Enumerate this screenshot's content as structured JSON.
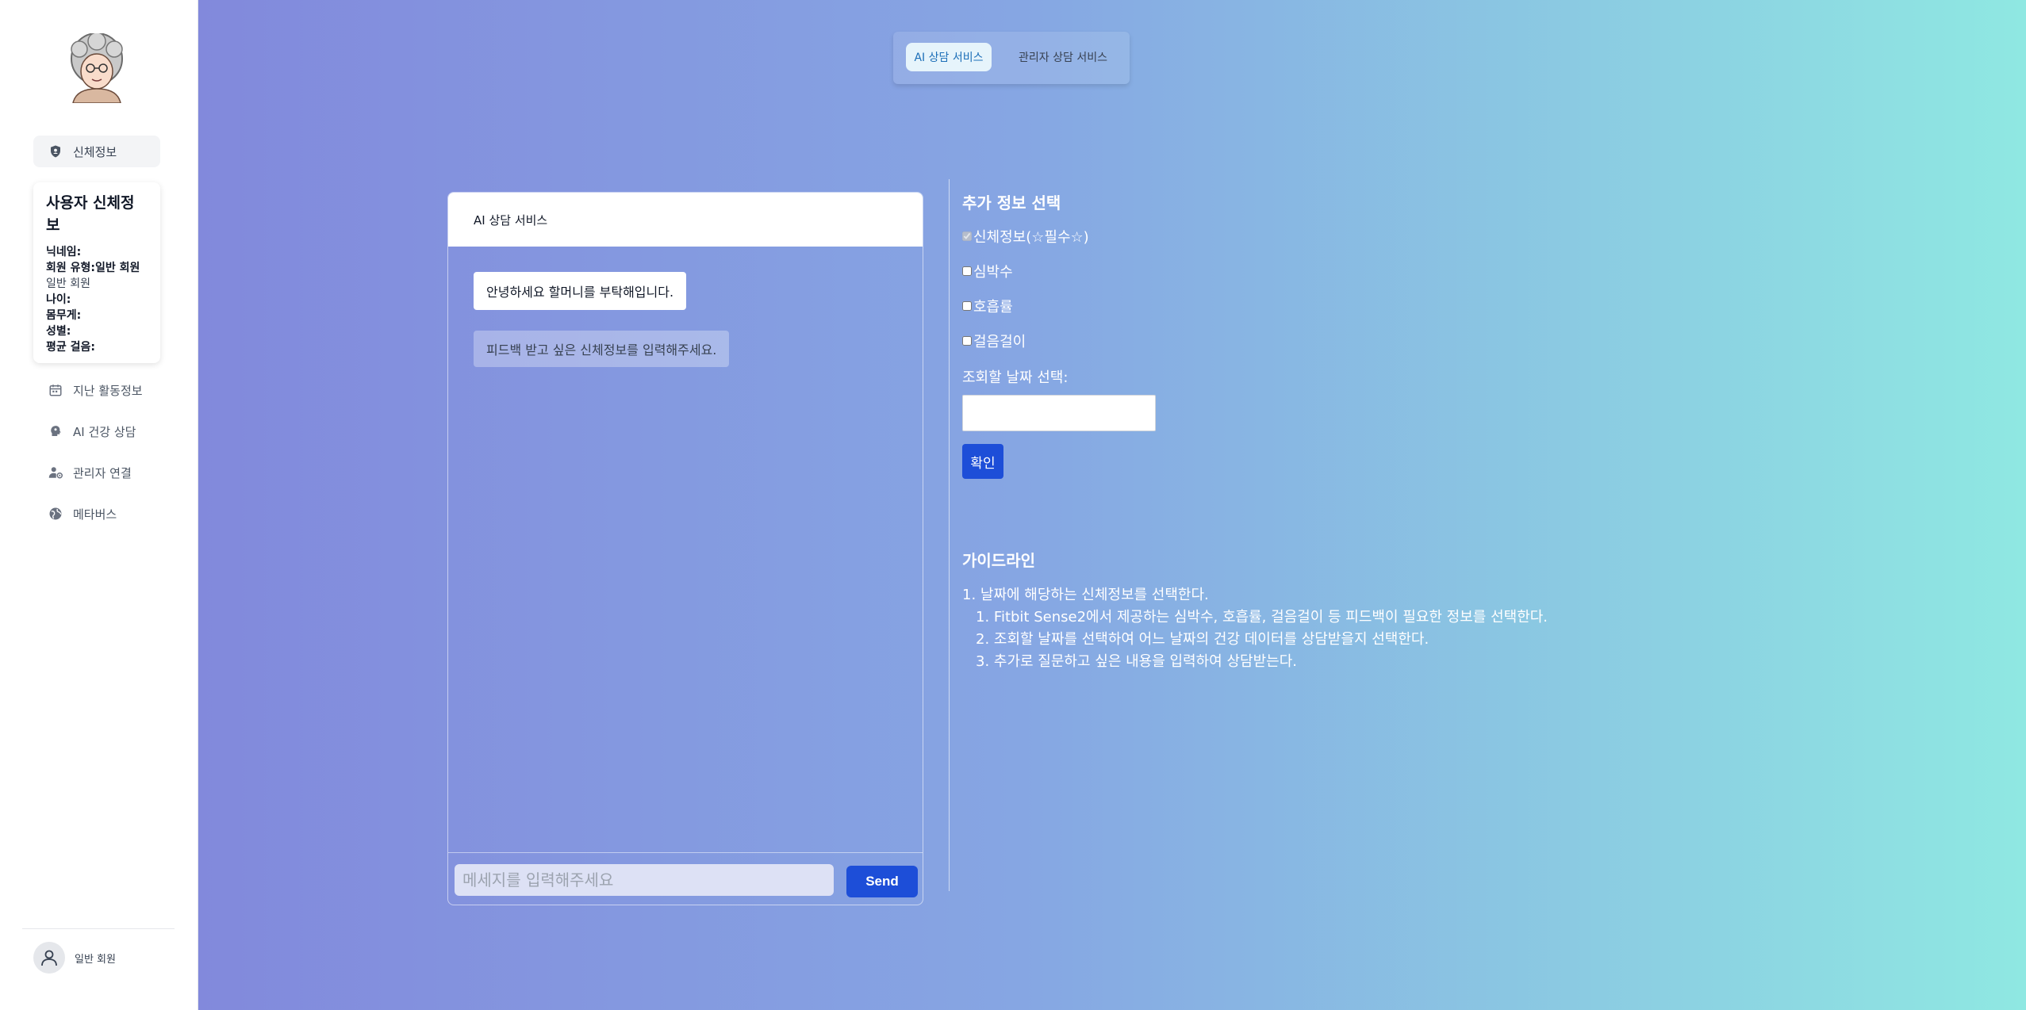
{
  "sidebar": {
    "nav_body": "신체정보",
    "profile": {
      "title": "사용자 신체정보",
      "nickname_label": "닉네임:",
      "member_type_label": "회원 유형:",
      "member_type_value": "일반 회원",
      "member_type_extra": "일반 회원",
      "age_label": "나이:",
      "weight_label": "몸무게:",
      "gender_label": "성별:",
      "avg_steps_label": "평균 걸음:"
    },
    "nav_items": [
      {
        "label": "지난 활동정보",
        "icon": "calendar-icon"
      },
      {
        "label": "AI 건강 상담",
        "icon": "ai-head-icon"
      },
      {
        "label": "관리자 연결",
        "icon": "user-gear-icon"
      },
      {
        "label": "메타버스",
        "icon": "globe-icon"
      }
    ],
    "footer_user": "일반 회원"
  },
  "tabs": {
    "ai": "AI 상담 서비스",
    "admin": "관리자 상담 서비스"
  },
  "chat": {
    "header": "AI 상담 서비스",
    "messages": [
      "안녕하세요 할머니를 부탁해입니다.",
      "피드백 받고 싶은 신체정보를 입력해주세요."
    ],
    "input_placeholder": "메세지를 입력해주세요",
    "send_label": "Send"
  },
  "extra_info": {
    "title": "추가 정보 선택",
    "options": [
      {
        "label": "신체정보(☆필수☆)",
        "checked": true,
        "disabled": true
      },
      {
        "label": "심박수",
        "checked": false
      },
      {
        "label": "호흡률",
        "checked": false
      },
      {
        "label": "걸음걸이",
        "checked": false
      }
    ],
    "date_label": "조회할 날짜 선택:",
    "confirm_label": "확인"
  },
  "guideline": {
    "title": "가이드라인",
    "main": "1. 날짜에 해당하는 신체정보를 선택한다.",
    "steps": [
      "1. Fitbit Sense2에서 제공하는 심박수, 호흡률, 걸음걸이 등 피드백이 필요한 정보를 선택한다.",
      "2. 조회할 날짜를 선택하여 어느 날짜의 건강 데이터를 상담받을지 선택한다.",
      "3. 추가로 질문하고 싶은 내용을 입력하여 상담받는다."
    ]
  },
  "colors": {
    "accent": "#1d4ed8",
    "gradient_start": "#8289dc",
    "gradient_end": "#8fe8e2"
  }
}
